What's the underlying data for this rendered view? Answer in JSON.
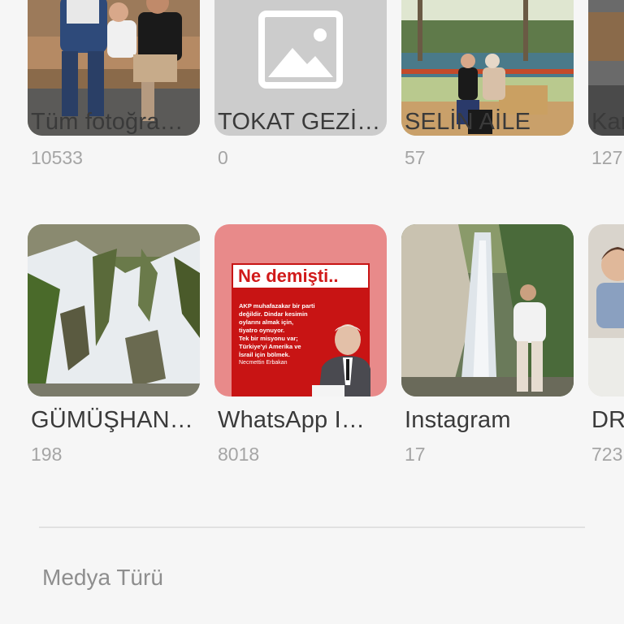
{
  "albums_row1": [
    {
      "name": "Tüm fotoğra…",
      "count": "10533"
    },
    {
      "name": "TOKAT GEZİ…",
      "count": "0"
    },
    {
      "name": "SELİN AİLE",
      "count": "57"
    },
    {
      "name": "Kar",
      "count": "127"
    }
  ],
  "albums_row2": [
    {
      "name": "GÜMÜŞHAN…",
      "count": "198"
    },
    {
      "name": "WhatsApp I…",
      "count": "8018"
    },
    {
      "name": "Instagram",
      "count": "17"
    },
    {
      "name": "DR",
      "count": "723"
    }
  ],
  "whatsapp_thumb": {
    "headline": "Ne demişti..",
    "lines": [
      "AKP muhafazakar bir parti",
      "değildir. Dindar kesimin",
      "oylarını almak için,",
      "tiyatro oynuyor.",
      "Tek bir misyonu var;",
      "Türkiye'yi Amerika ve",
      "İsrail için bölmek."
    ],
    "author": "Necmettin Erbakan"
  },
  "section": {
    "media_type_title": "Medya Türü"
  },
  "colors": {
    "background": "#f6f6f6",
    "album_name": "#3a3a3a",
    "album_count": "#a5a5a5",
    "section_title": "#8e8e8e",
    "placeholder": "#cccccc",
    "whatsapp_red": "#d11a1a"
  }
}
